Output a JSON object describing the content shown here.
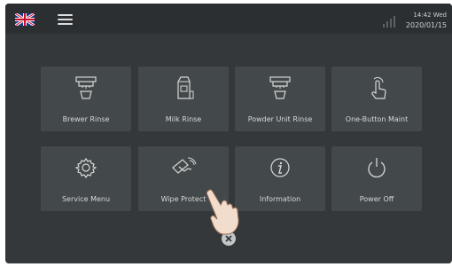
{
  "status_bar": {
    "time_day": "14:42 Wed",
    "date": "2020/01/15"
  },
  "icons": {
    "flag": "uk-flag-icon",
    "menu": "hamburger-menu-icon",
    "signal": "signal-strength-icon",
    "close": "close-icon"
  },
  "tiles": [
    {
      "label": "Brewer Rinse",
      "icon": "brewer-rinse-icon"
    },
    {
      "label": "Milk Rinse",
      "icon": "milk-rinse-icon"
    },
    {
      "label": "Powder Unit Rinse",
      "icon": "powder-unit-rinse-icon"
    },
    {
      "label": "One-Button Maint",
      "icon": "one-button-touch-icon"
    },
    {
      "label": "Service Menu",
      "icon": "gear-icon"
    },
    {
      "label": "Wipe Protect",
      "icon": "wipe-hand-icon"
    },
    {
      "label": "Information",
      "icon": "info-icon"
    },
    {
      "label": "Power Off",
      "icon": "power-icon"
    }
  ],
  "colors": {
    "background": "#34383a",
    "topbar": "#2b2f31",
    "tile": "#43484a",
    "text": "#d6d8d8"
  }
}
